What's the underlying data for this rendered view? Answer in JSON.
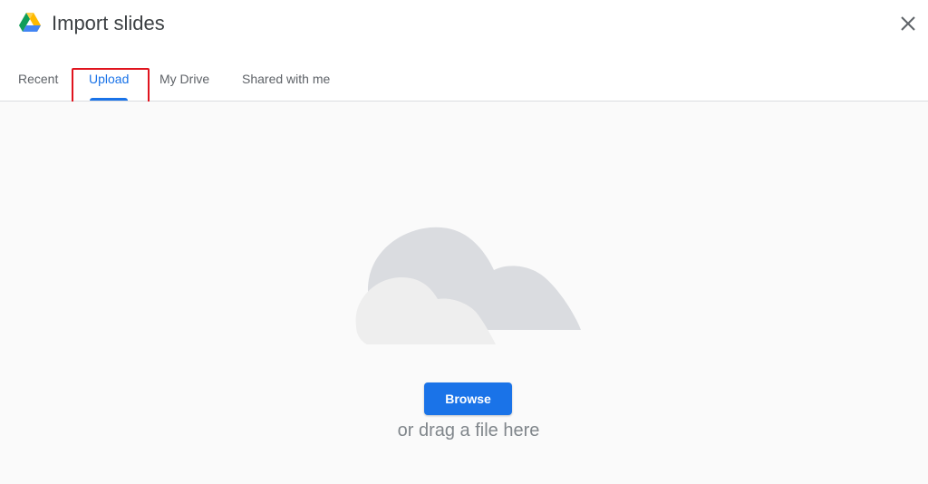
{
  "dialog": {
    "title": "Import slides",
    "logo_icon": "google-drive-icon",
    "close_icon": "close-icon"
  },
  "tabs": [
    {
      "label": "Recent",
      "selected": false
    },
    {
      "label": "Upload",
      "selected": true
    },
    {
      "label": "My Drive",
      "selected": false
    },
    {
      "label": "Shared with me",
      "selected": false
    }
  ],
  "upload": {
    "illustration_icon": "cloud-icon",
    "browse_label": "Browse",
    "drag_text": "or drag a file here"
  },
  "colors": {
    "accent": "#1a73e8",
    "highlight_box": "#e0141e"
  }
}
